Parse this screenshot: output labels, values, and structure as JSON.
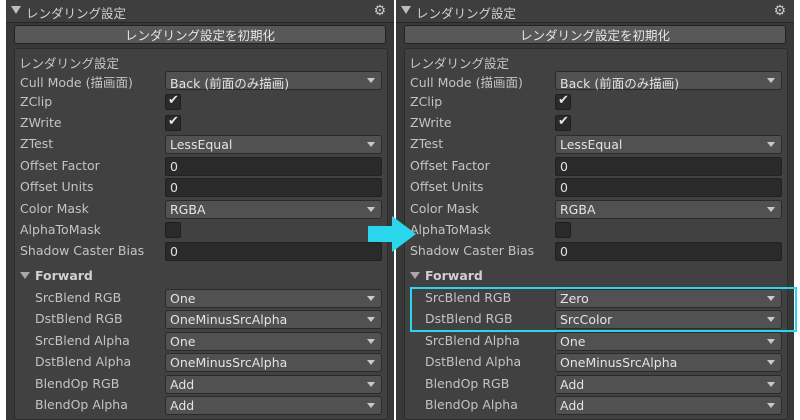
{
  "panels": [
    {
      "header_title": "レンダリング設定",
      "reset_button": "レンダリング設定を初期化",
      "section_title": "レンダリング設定",
      "fields": [
        {
          "label": "Cull Mode (描画面)",
          "type": "dropdown",
          "value": "Back (前面のみ描画)"
        },
        {
          "label": "ZClip",
          "type": "checkbox",
          "value": "✔"
        },
        {
          "label": "ZWrite",
          "type": "checkbox",
          "value": "✔"
        },
        {
          "label": "ZTest",
          "type": "dropdown",
          "value": "LessEqual"
        },
        {
          "label": "Offset Factor",
          "type": "text",
          "value": "0"
        },
        {
          "label": "Offset Units",
          "type": "text",
          "value": "0"
        },
        {
          "label": "Color Mask",
          "type": "dropdown",
          "value": "RGBA"
        },
        {
          "label": "AlphaToMask",
          "type": "checkbox",
          "value": ""
        },
        {
          "label": "Shadow Caster Bias",
          "type": "text",
          "value": "0"
        }
      ],
      "forward_title": "Forward",
      "blend_fields": [
        {
          "label": "SrcBlend RGB",
          "value": "One"
        },
        {
          "label": "DstBlend RGB",
          "value": "OneMinusSrcAlpha"
        },
        {
          "label": "SrcBlend Alpha",
          "value": "One"
        },
        {
          "label": "DstBlend Alpha",
          "value": "OneMinusSrcAlpha"
        },
        {
          "label": "BlendOp RGB",
          "value": "Add"
        },
        {
          "label": "BlendOp Alpha",
          "value": "Add"
        }
      ]
    },
    {
      "header_title": "レンダリング設定",
      "reset_button": "レンダリング設定を初期化",
      "section_title": "レンダリング設定",
      "fields": [
        {
          "label": "Cull Mode (描画面)",
          "type": "dropdown",
          "value": "Back (前面のみ描画)"
        },
        {
          "label": "ZClip",
          "type": "checkbox",
          "value": "✔"
        },
        {
          "label": "ZWrite",
          "type": "checkbox",
          "value": "✔"
        },
        {
          "label": "ZTest",
          "type": "dropdown",
          "value": "LessEqual"
        },
        {
          "label": "Offset Factor",
          "type": "text",
          "value": "0"
        },
        {
          "label": "Offset Units",
          "type": "text",
          "value": "0"
        },
        {
          "label": "Color Mask",
          "type": "dropdown",
          "value": "RGBA"
        },
        {
          "label": "AlphaToMask",
          "type": "checkbox",
          "value": ""
        },
        {
          "label": "Shadow Caster Bias",
          "type": "text",
          "value": "0"
        }
      ],
      "forward_title": "Forward",
      "blend_fields": [
        {
          "label": "SrcBlend RGB",
          "value": "Zero"
        },
        {
          "label": "DstBlend RGB",
          "value": "SrcColor"
        },
        {
          "label": "SrcBlend Alpha",
          "value": "One"
        },
        {
          "label": "DstBlend Alpha",
          "value": "OneMinusSrcAlpha"
        },
        {
          "label": "BlendOp RGB",
          "value": "Add"
        },
        {
          "label": "BlendOp Alpha",
          "value": "Add"
        }
      ]
    }
  ],
  "icons": {
    "header_gear": "gear-icon",
    "transition_arrow": "right-arrow-icon"
  },
  "colors": {
    "highlight": "#2ad6ec",
    "arrow": "#2ad6ec",
    "panel_bg": "#383838"
  }
}
